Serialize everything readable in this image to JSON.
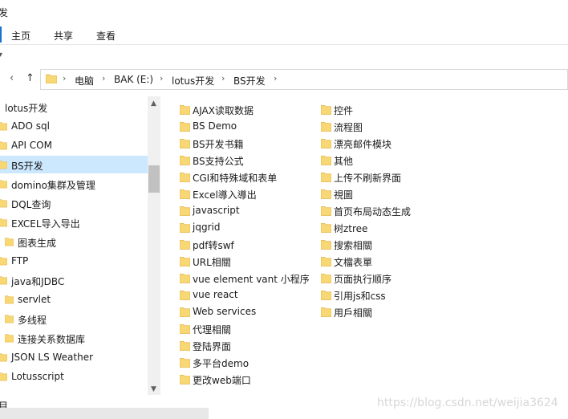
{
  "window": {
    "title": "发"
  },
  "ribbon": {
    "tabs": [
      "主页",
      "共享",
      "查看"
    ]
  },
  "nav": {
    "back": "‹",
    "up": "↑",
    "breadcrumbs": [
      "电脑",
      "BAK (E:)",
      "lotus开发",
      "BS开发"
    ],
    "separator": "›"
  },
  "tree": {
    "root": "lotus开发",
    "items": [
      {
        "label": "ADO sql"
      },
      {
        "label": "API COM"
      },
      {
        "label": "BS开发",
        "selected": true
      },
      {
        "label": "domino集群及管理"
      },
      {
        "label": "DQL查询"
      },
      {
        "label": "EXCEL导入导出"
      },
      {
        "label": "图表生成",
        "indent": true
      },
      {
        "label": "FTP"
      },
      {
        "label": "java和JDBC"
      },
      {
        "label": "servlet",
        "indent": true
      },
      {
        "label": "多线程",
        "indent": true
      },
      {
        "label": "连接关系数据库",
        "indent": true
      },
      {
        "label": "JSON LS Weather"
      },
      {
        "label": "Lotusscript"
      }
    ]
  },
  "files": {
    "col1": [
      "AJAX读取数据",
      "BS Demo",
      "BS开发书籍",
      "BS支持公式",
      "CGI和特殊域和表单",
      "Excel導入導出",
      "javascript",
      "jqgrid",
      "pdf转swf",
      "URL相關",
      "vue element vant 小程序",
      "vue react",
      "Web services",
      "代理相關",
      "登陆界面",
      "多平台demo",
      "更改web端口"
    ],
    "col2": [
      "控件",
      "流程图",
      "漂亮邮件模块",
      "其他",
      "上传不刷新界面",
      "視圖",
      "首页布局动态生成",
      "树ztree",
      "搜索相關",
      "文檔表單",
      "页面执行顺序",
      "引用js和css",
      "用戶相關"
    ]
  },
  "status": {
    "text": "目"
  },
  "watermark": "https://blog.csdn.net/weijia3624",
  "colors": {
    "folder": "#f8d775",
    "folder_dark": "#e6b84a",
    "selected": "#cce8ff",
    "accent": "#1a6fd1"
  }
}
